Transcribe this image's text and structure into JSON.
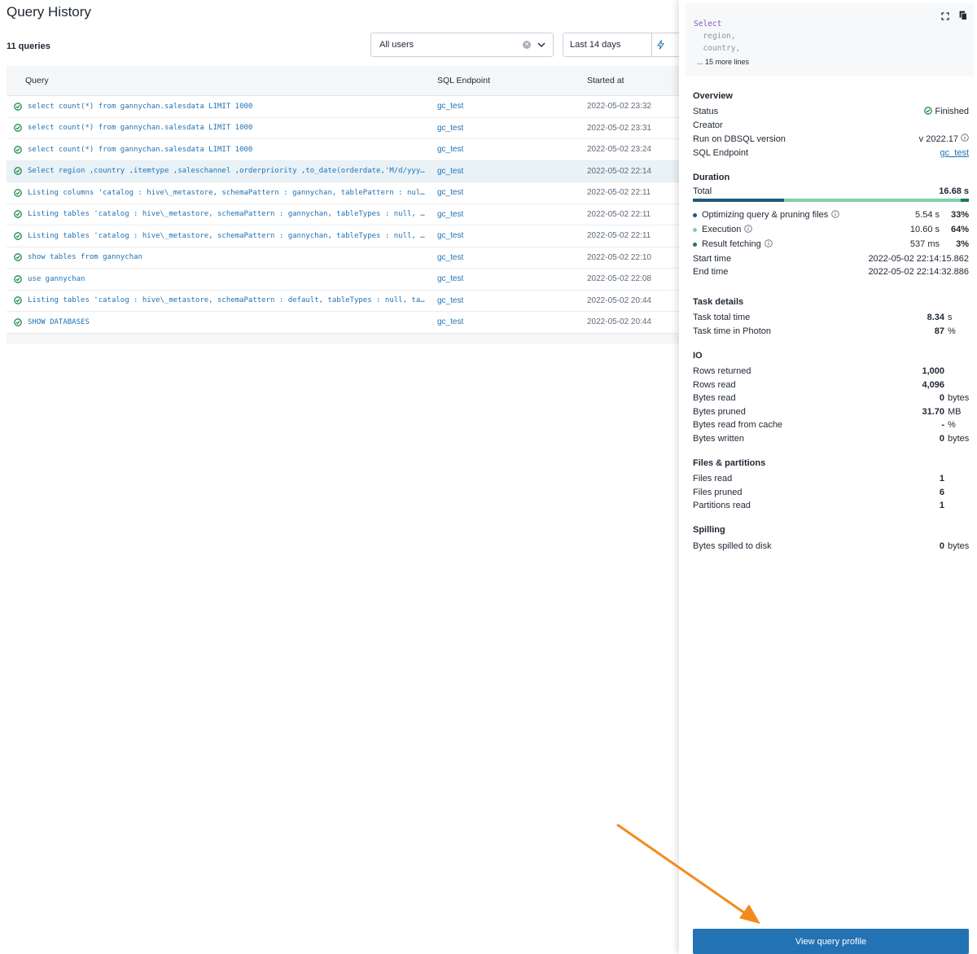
{
  "header": {
    "title": "Query History",
    "count_label": "11 queries"
  },
  "filters": {
    "users": "All users",
    "dates": "Last 14 days"
  },
  "table": {
    "columns": {
      "query": "Query",
      "endpoint": "SQL Endpoint",
      "started": "Started at"
    },
    "rows": [
      {
        "query": "select count(*) from gannychan.salesdata LIMIT 1000",
        "endpoint": "gc_test",
        "started": "2022-05-02 23:32"
      },
      {
        "query": "select count(*) from gannychan.salesdata LIMIT 1000",
        "endpoint": "gc_test",
        "started": "2022-05-02 23:31"
      },
      {
        "query": "select count(*) from gannychan.salesdata LIMIT 1000",
        "endpoint": "gc_test",
        "started": "2022-05-02 23:24"
      },
      {
        "query": "Select region ,country ,itemtype ,saleschannel ,orderpriority ,to_date(orderdate,'M/d/yyyy') as orderdate",
        "endpoint": "gc_test",
        "started": "2022-05-02 22:14",
        "selected": true
      },
      {
        "query": "Listing columns 'catalog : hive\\_metastore, schemaPattern : gannychan, tablePattern : null, columnPattern : null'",
        "endpoint": "gc_test",
        "started": "2022-05-02 22:11"
      },
      {
        "query": "Listing tables 'catalog : hive\\_metastore, schemaPattern : gannychan, tableTypes : null, tablePattern : null'",
        "endpoint": "gc_test",
        "started": "2022-05-02 22:11"
      },
      {
        "query": "Listing tables 'catalog : hive\\_metastore, schemaPattern : gannychan, tableTypes : null, tablePattern : null'",
        "endpoint": "gc_test",
        "started": "2022-05-02 22:11"
      },
      {
        "query": "show tables from gannychan",
        "endpoint": "gc_test",
        "started": "2022-05-02 22:10"
      },
      {
        "query": "use gannychan",
        "endpoint": "gc_test",
        "started": "2022-05-02 22:08"
      },
      {
        "query": "Listing tables 'catalog : hive\\_metastore, schemaPattern : default, tableTypes : null, tablePattern : null'",
        "endpoint": "gc_test",
        "started": "2022-05-02 20:44"
      },
      {
        "query": "SHOW DATABASES",
        "endpoint": "gc_test",
        "started": "2022-05-02 20:44"
      }
    ]
  },
  "panel": {
    "code": {
      "line1": "Select",
      "line2": "  region,",
      "line3": "  country,",
      "more": "... 15 more lines"
    },
    "overview": {
      "title": "Overview",
      "status_label": "Status",
      "status_value": "Finished",
      "creator_label": "Creator",
      "dbsql_label": "Run on DBSQL version",
      "dbsql_value": "v 2022.17",
      "endpoint_label": "SQL Endpoint",
      "endpoint_value": "gc_test"
    },
    "duration": {
      "title": "Duration",
      "total_label": "Total",
      "total_value": "16.68 s",
      "items": [
        {
          "label": "Optimizing query & pruning files",
          "time": "5.54 s",
          "pct": "33%",
          "color": "#1e5a78"
        },
        {
          "label": "Execution",
          "time": "10.60 s",
          "pct": "64%",
          "color": "#7fd1a9"
        },
        {
          "label": "Result fetching",
          "time": "537 ms",
          "pct": "3%",
          "color": "#1f7a52"
        }
      ],
      "start_label": "Start time",
      "start_value": "2022-05-02 22:14:15.862",
      "end_label": "End time",
      "end_value": "2022-05-02 22:14:32.886"
    },
    "task": {
      "title": "Task details",
      "total_label": "Task total time",
      "total_value": "8.34",
      "total_unit": "s",
      "photon_label": "Task time in Photon",
      "photon_value": "87",
      "photon_unit": "%"
    },
    "io": {
      "title": "IO",
      "rows": [
        {
          "label": "Rows returned",
          "value": "1,000",
          "unit": ""
        },
        {
          "label": "Rows read",
          "value": "4,096",
          "unit": ""
        },
        {
          "label": "Bytes read",
          "value": "0",
          "unit": "bytes"
        },
        {
          "label": "Bytes pruned",
          "value": "31.70",
          "unit": "MB"
        },
        {
          "label": "Bytes read from cache",
          "value": "-",
          "unit": "%"
        },
        {
          "label": "Bytes written",
          "value": "0",
          "unit": "bytes"
        }
      ]
    },
    "files": {
      "title": "Files & partitions",
      "rows": [
        {
          "label": "Files read",
          "value": "1"
        },
        {
          "label": "Files pruned",
          "value": "6"
        },
        {
          "label": "Partitions read",
          "value": "1"
        }
      ]
    },
    "spilling": {
      "title": "Spilling",
      "label": "Bytes spilled to disk",
      "value": "0",
      "unit": "bytes"
    },
    "button_label": "View query profile"
  },
  "colors": {
    "accent": "#2272b4",
    "success": "#1f8a4c",
    "annotation_arrow": "#f38b1c"
  }
}
